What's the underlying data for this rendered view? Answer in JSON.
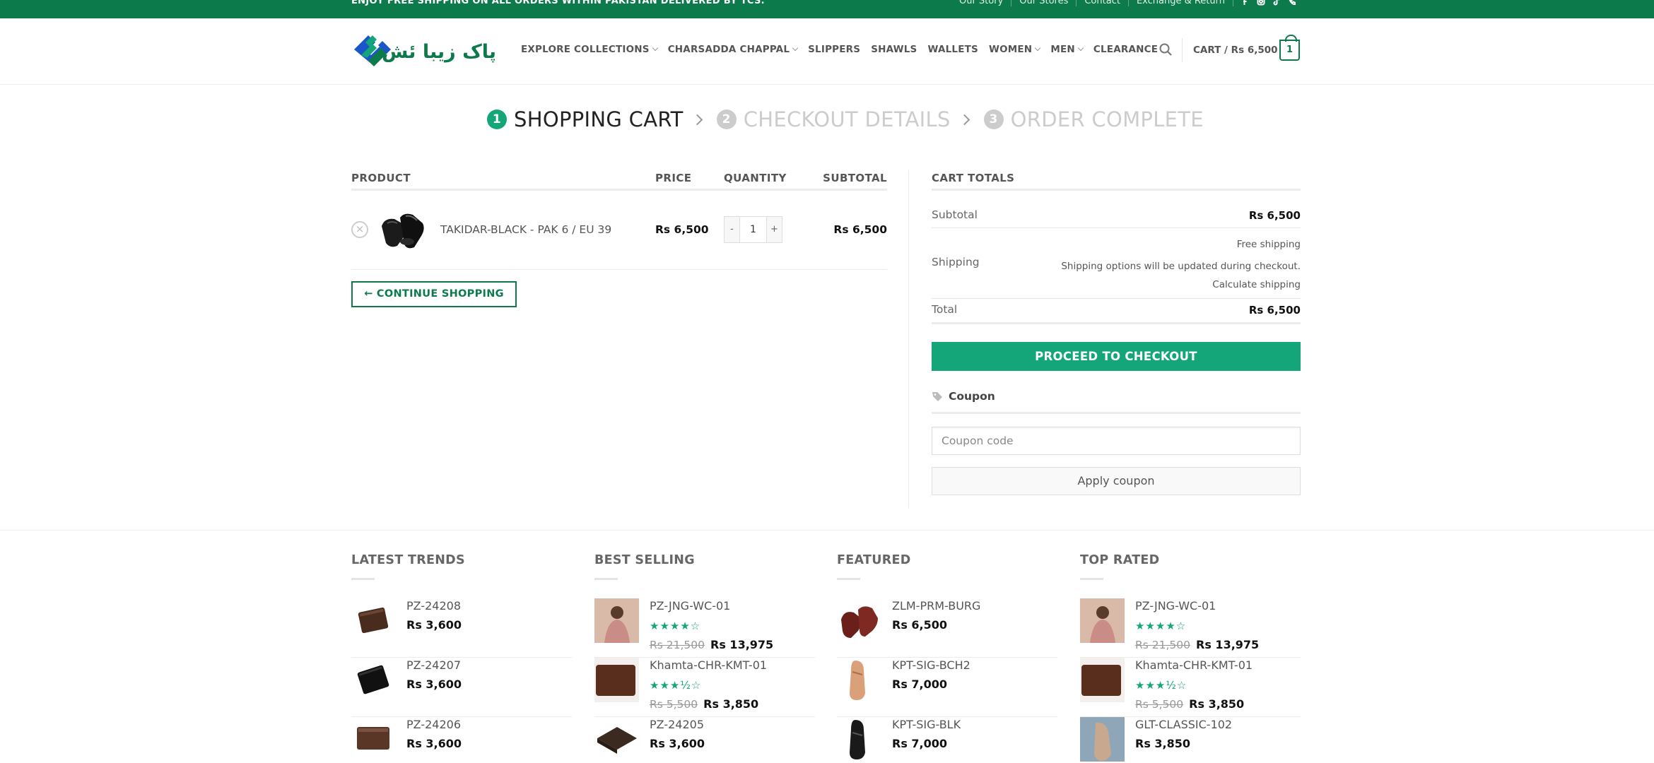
{
  "topbar": {
    "message": "ENJOY FREE SHIPPING ON ALL ORDERS WITHIN PAKISTAN DELIVERED BY TCS.",
    "links": [
      "Our Story",
      "Our Stores",
      "Contact",
      "Exchange & Return"
    ],
    "social_icons": [
      "facebook-icon",
      "instagram-icon",
      "tiktok-icon",
      "phone-icon"
    ]
  },
  "header": {
    "logo_text": "پاک زیبا ئش",
    "nav": [
      {
        "label": "EXPLORE COLLECTIONS",
        "dropdown": true
      },
      {
        "label": "CHARSADDA CHAPPAL",
        "dropdown": true
      },
      {
        "label": "SLIPPERS",
        "dropdown": false
      },
      {
        "label": "SHAWLS",
        "dropdown": false
      },
      {
        "label": "WALLETS",
        "dropdown": false
      },
      {
        "label": "WOMEN",
        "dropdown": true
      },
      {
        "label": "MEN",
        "dropdown": true
      },
      {
        "label": "CLEARANCE",
        "dropdown": false
      }
    ],
    "cart_label": "CART / Rs 6,500",
    "cart_count": "1"
  },
  "steps": [
    {
      "num": "1",
      "label": "SHOPPING CART"
    },
    {
      "num": "2",
      "label": "CHECKOUT DETAILS"
    },
    {
      "num": "3",
      "label": "ORDER COMPLETE"
    }
  ],
  "cart": {
    "headers": {
      "product": "PRODUCT",
      "price": "PRICE",
      "quantity": "QUANTITY",
      "subtotal": "SUBTOTAL"
    },
    "items": [
      {
        "name": "TAKIDAR-BLACK - PAK 6 / EU 39",
        "price": "Rs 6,500",
        "quantity": "1",
        "subtotal": "Rs 6,500"
      }
    ],
    "qty_minus": "-",
    "qty_plus": "+",
    "continue_label": "← CONTINUE SHOPPING"
  },
  "totals": {
    "title": "CART TOTALS",
    "subtotal_label": "Subtotal",
    "subtotal_value": "Rs 6,500",
    "shipping_label": "Shipping",
    "shipping_method": "Free shipping",
    "shipping_note": "Shipping options will be updated during checkout.",
    "calculate_link": "Calculate shipping",
    "total_label": "Total",
    "total_value": "Rs 6,500",
    "checkout_label": "PROCEED TO CHECKOUT",
    "coupon_heading": "Coupon",
    "coupon_placeholder": "Coupon code",
    "apply_label": "Apply coupon"
  },
  "widgets": [
    {
      "title": "LATEST TRENDS",
      "items": [
        {
          "name": "PZ-24208",
          "price": "Rs 3,600"
        },
        {
          "name": "PZ-24207",
          "price": "Rs 3,600"
        },
        {
          "name": "PZ-24206",
          "price": "Rs 3,600"
        }
      ]
    },
    {
      "title": "BEST SELLING",
      "items": [
        {
          "name": "PZ-JNG-WC-01",
          "rating": 4,
          "old_price": "Rs 21,500",
          "price": "Rs 13,975"
        },
        {
          "name": "Khamta-CHR-KMT-01",
          "rating": 3.5,
          "old_price": "Rs 5,500",
          "price": "Rs 3,850"
        },
        {
          "name": "PZ-24205",
          "price": "Rs 3,600"
        }
      ]
    },
    {
      "title": "FEATURED",
      "items": [
        {
          "name": "ZLM-PRM-BURG",
          "price": "Rs 6,500"
        },
        {
          "name": "KPT-SIG-BCH2",
          "price": "Rs 7,000"
        },
        {
          "name": "KPT-SIG-BLK",
          "price": "Rs 7,000"
        }
      ]
    },
    {
      "title": "TOP RATED",
      "items": [
        {
          "name": "PZ-JNG-WC-01",
          "rating": 4,
          "old_price": "Rs 21,500",
          "price": "Rs 13,975"
        },
        {
          "name": "Khamta-CHR-KMT-01",
          "rating": 3.5,
          "old_price": "Rs 5,500",
          "price": "Rs 3,850"
        },
        {
          "name": "GLT-CLASSIC-102",
          "price": "Rs 3,850"
        }
      ]
    }
  ],
  "colors": {
    "brand_green": "#0c7a4b",
    "accent_green": "#14a678"
  }
}
